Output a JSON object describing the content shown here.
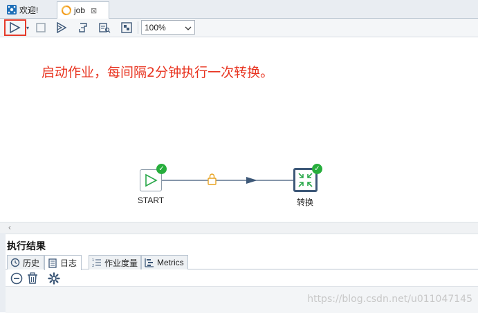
{
  "tabs": [
    {
      "label": "欢迎!",
      "icon": "welcome-icon"
    },
    {
      "label": "job",
      "icon": "job-icon",
      "close": "⊠"
    }
  ],
  "toolbar": {
    "zoom_value": "100%",
    "buttons": [
      "run-icon",
      "stop-icon",
      "debug-run-icon",
      "replay-icon",
      "check-icon",
      "grid-icon"
    ]
  },
  "canvas": {
    "note": "启动作业，每间隔2分钟执行一次转换。",
    "nodes": [
      {
        "name": "START",
        "status": "success"
      },
      {
        "name": "转换",
        "status": "success"
      }
    ]
  },
  "results": {
    "title": "执行结果",
    "tabs": [
      "历史",
      "日志",
      "作业度量",
      "Metrics"
    ],
    "active_tab": "日志"
  },
  "watermark": "https://blog.csdn.net/u011047145",
  "colors": {
    "highlight_border": "#e53a2a",
    "note_text": "#e8331f",
    "success_badge": "#27ae3c",
    "hop_line": "#3d5878",
    "lock_icon": "#e8a21e"
  }
}
